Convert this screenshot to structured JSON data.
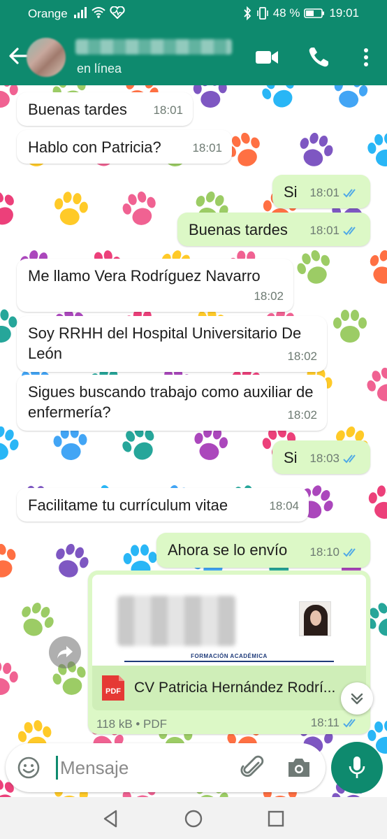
{
  "status_bar": {
    "carrier": "Orange",
    "battery": "48 %",
    "time": "19:01"
  },
  "header": {
    "presence": "en línea",
    "icons": [
      "back-arrow-icon",
      "video-call-icon",
      "phone-icon",
      "more-vert-icon"
    ]
  },
  "messages": [
    {
      "direction": "in",
      "text": "Buenas tardes",
      "time": "18:01"
    },
    {
      "direction": "in",
      "text": "Hablo con Patricia?",
      "time": "18:01"
    },
    {
      "direction": "out",
      "text": "Si",
      "time": "18:01"
    },
    {
      "direction": "out",
      "text": "Buenas tardes",
      "time": "18:01"
    },
    {
      "direction": "in",
      "text": "Me llamo Vera Rodríguez Navarro",
      "time": "18:02"
    },
    {
      "direction": "in",
      "text": "Soy RRHH del Hospital Universitario De León",
      "time": "18:02"
    },
    {
      "direction": "in",
      "text": "Sigues buscando trabajo como auxiliar de enfermería?",
      "time": "18:02"
    },
    {
      "direction": "out",
      "text": "Si",
      "time": "18:03"
    },
    {
      "direction": "in",
      "text": "Facilitame tu currículum vitae",
      "time": "18:04"
    },
    {
      "direction": "out",
      "text": "Ahora se lo envío",
      "time": "18:10"
    }
  ],
  "document": {
    "preview_heading": "FORMACIÓN ACADÉMICA",
    "file_type_badge": "PDF",
    "filename": "CV Patricia Hernández Rodrí...",
    "size_info": "118 kB • PDF",
    "time": "18:11"
  },
  "composer": {
    "placeholder": "Mensaje"
  },
  "colors": {
    "header": "#0e8a6e",
    "outgoing_bubble": "#dcf8c6",
    "incoming_bubble": "#ffffff",
    "read_ticks": "#4fa9e6"
  }
}
